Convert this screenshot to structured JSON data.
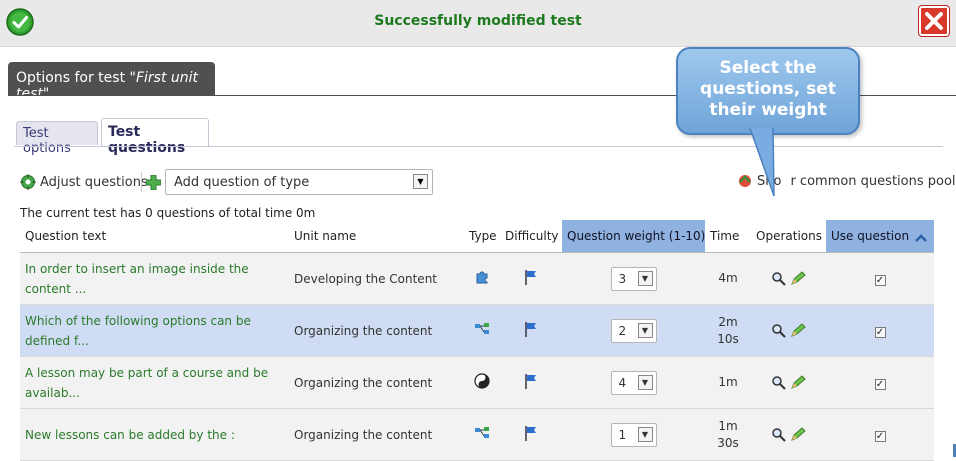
{
  "message": {
    "text": "Successfully modified test",
    "icon": "check-circle-icon",
    "close_icon": "close-icon"
  },
  "options_bar": {
    "label": "Options for test ",
    "test_name": "\"First unit test\""
  },
  "tabs": [
    {
      "label": "Test options",
      "active": false
    },
    {
      "label": "Test questions",
      "active": true
    }
  ],
  "toolbar": {
    "adjust_label": "Adjust questions",
    "add_select_value": "Add question of type",
    "pool_prefix": "Sho",
    "pool_suffix": "r common questions pool"
  },
  "callout": {
    "text": "Select the questions, set their weight"
  },
  "info": "The current test has 0 questions of total time 0m",
  "table": {
    "headers": [
      "Question text",
      "Unit name",
      "Type",
      "Difficulty",
      "Question weight (1-10)",
      "Time",
      "Operations",
      "Use question"
    ],
    "rows": [
      {
        "text": "In order to insert an image inside the content ...",
        "unit": "Developing the Content",
        "type_icon": "puzzle-icon",
        "weight": "3",
        "time1": "4m",
        "time2": "",
        "used": true
      },
      {
        "text": "Which of the following options can be defined f...",
        "unit": "Organizing the content",
        "type_icon": "match-icon",
        "weight": "2",
        "time1": "2m",
        "time2": "10s",
        "used": true
      },
      {
        "text": "A lesson may be part of a course and be availab...",
        "unit": "Organizing the content",
        "type_icon": "yinyang-icon",
        "weight": "4",
        "time1": "1m",
        "time2": "",
        "used": true
      },
      {
        "text": "New lessons can be added by the :",
        "unit": "Organizing the content",
        "type_icon": "match-icon",
        "weight": "1",
        "time1": "1m",
        "time2": "30s",
        "used": true
      }
    ]
  },
  "colors": {
    "success": "#1e7a1e",
    "link": "#2b7a2b",
    "header_highlight": "#8fb2e0",
    "row_selected": "#cfdcf3",
    "callout": "#7fb1e2"
  }
}
